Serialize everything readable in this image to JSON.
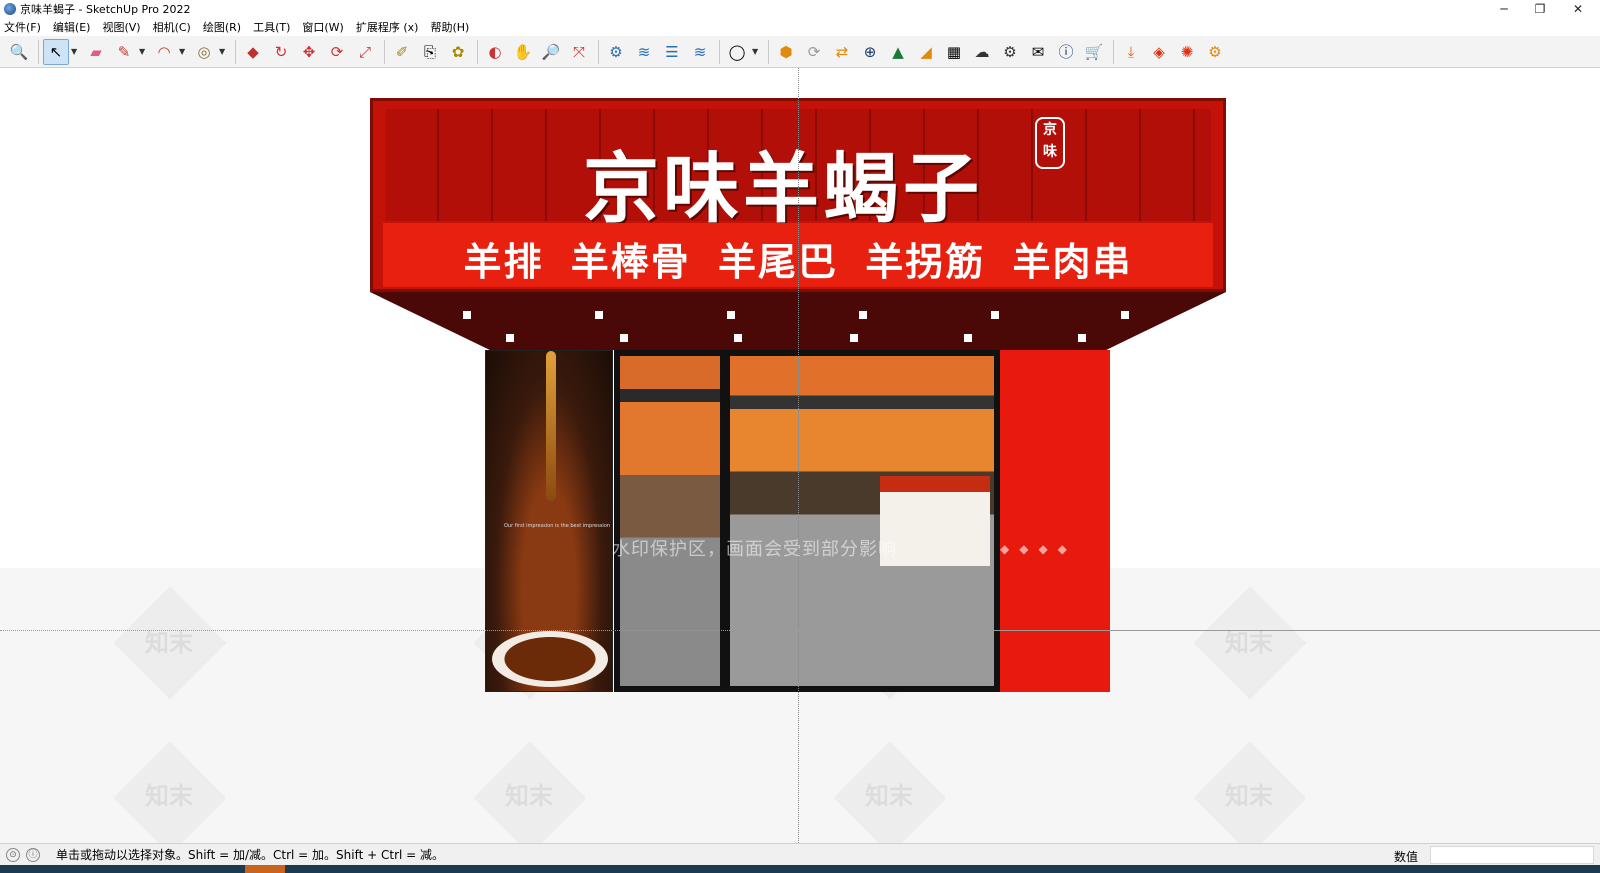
{
  "window": {
    "title": "京味羊蝎子 - SketchUp Pro 2022",
    "controls": [
      "─",
      "❐",
      "✕"
    ]
  },
  "menu": [
    "文件(F)",
    "编辑(E)",
    "视图(V)",
    "相机(C)",
    "绘图(R)",
    "工具(T)",
    "窗口(W)",
    "扩展程序 (x)",
    "帮助(H)"
  ],
  "toolbar": {
    "icons": [
      "zoom-icon",
      "select-icon",
      "eraser-icon",
      "pencil-icon",
      "arc-icon",
      "paint-bucket-icon",
      "push-pull-icon",
      "follow-me-icon",
      "move-icon",
      "rotate-icon",
      "scale-icon",
      "tape-measure-icon",
      "text-icon",
      "paint-icon",
      "section-plane-icon",
      "orbit-icon",
      "pan-icon",
      "zoom-extents-icon",
      "component-icon",
      "sandbox-icon",
      "layers-icon",
      "styles-icon",
      "user-icon",
      "plugin-icon",
      "refresh-icon",
      "swap-icon",
      "add-icon",
      "tree-icon",
      "terrain-icon",
      "checker-icon",
      "cloud-upload-icon",
      "settings-icon",
      "mail-icon",
      "info-icon",
      "cart-icon",
      "download-icon",
      "layers-orange-icon",
      "render-icon",
      "gear-orange-icon"
    ]
  },
  "scene": {
    "shop_name": "京味羊蝎子",
    "seal": "京味",
    "slogan": "羊排 羊棒骨 羊尾巴 羊拐筋 羊肉串",
    "watermark": "水印保护区，画面会受到部分影响",
    "watermark_brand": "知末",
    "poster_caption": "Our first impression is the best impression"
  },
  "status": {
    "message": "单击或拖动以选择对象。Shift = 加/减。Ctrl = 加。Shift + Ctrl = 减。",
    "vcb_label": "数值",
    "vcb_value": ""
  }
}
